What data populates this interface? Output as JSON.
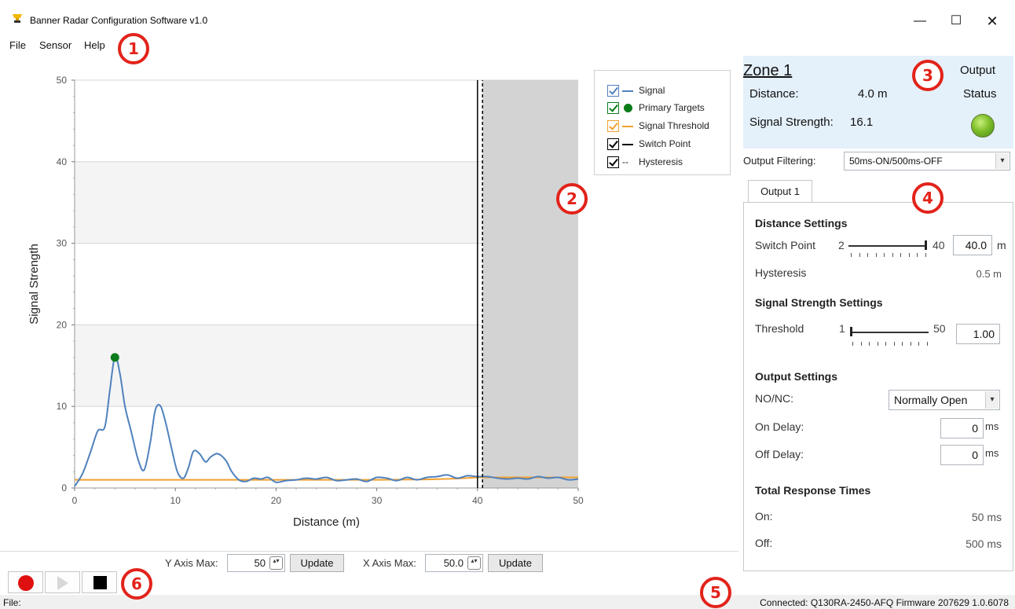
{
  "window": {
    "title": "Banner Radar Configuration Software v1.0",
    "minimize": "—",
    "maximize": "☐",
    "close": "✕"
  },
  "menu": {
    "file": "File",
    "sensor": "Sensor",
    "help": "Help"
  },
  "callouts": [
    "1",
    "2",
    "3",
    "4",
    "5",
    "6"
  ],
  "chart_data": {
    "type": "line",
    "xlabel": "Distance (m)",
    "ylabel": "Signal Strength",
    "xlim": [
      0,
      50
    ],
    "ylim": [
      0,
      50
    ],
    "xticks": [
      0,
      10,
      20,
      30,
      40,
      50
    ],
    "yticks": [
      0,
      10,
      20,
      30,
      40,
      50
    ],
    "grid": true,
    "legend_position": "top-right",
    "series": [
      {
        "name": "Signal",
        "color": "#4f81bd",
        "x": [
          0,
          0.8,
          1.6,
          2.3,
          3.0,
          3.5,
          4.0,
          4.5,
          5.0,
          5.6,
          6.3,
          6.9,
          7.5,
          8.0,
          8.5,
          9.0,
          9.6,
          10.2,
          10.8,
          11.3,
          11.8,
          12.4,
          13.0,
          13.5,
          14.2,
          15.0,
          15.6,
          16.3,
          17.0,
          17.8,
          18.5,
          19.2,
          20.0,
          21.0,
          22.0,
          23.0,
          24.0,
          25.0,
          26.0,
          27.0,
          28.0,
          29.0,
          30.0,
          31.0,
          32.0,
          33.0,
          34.0,
          35.0,
          36.0,
          37.0,
          38.0,
          39.0,
          40.0,
          41.0,
          42.0,
          43.0,
          44.0,
          45.0,
          46.0,
          47.0,
          48.0,
          49.0,
          50.0
        ],
        "y": [
          0.2,
          1.8,
          4.5,
          7.0,
          7.5,
          12.0,
          16.1,
          14.0,
          10.0,
          7.0,
          3.5,
          2.2,
          5.5,
          9.5,
          10.1,
          8.2,
          5.0,
          2.0,
          1.2,
          2.5,
          4.5,
          4.2,
          3.2,
          3.8,
          4.2,
          3.4,
          2.0,
          1.0,
          0.8,
          1.2,
          1.1,
          1.3,
          0.7,
          0.9,
          1.0,
          1.2,
          1.1,
          1.3,
          0.9,
          1.0,
          1.1,
          0.8,
          1.3,
          1.2,
          0.9,
          1.3,
          1.0,
          1.3,
          1.4,
          1.6,
          1.2,
          1.5,
          1.4,
          1.4,
          1.2,
          1.1,
          1.2,
          1.1,
          1.4,
          1.2,
          1.3,
          1.0,
          1.1
        ]
      },
      {
        "name": "Primary Targets",
        "color": "#0b7c1a",
        "x": [
          4.0
        ],
        "y": [
          16.0
        ]
      },
      {
        "name": "Signal Threshold",
        "color": "#f0a030",
        "x": [
          0,
          10,
          20,
          30,
          35,
          38,
          40,
          50
        ],
        "y": [
          1.0,
          1.0,
          1.0,
          1.0,
          1.05,
          1.15,
          1.3,
          1.3
        ]
      },
      {
        "name": "Switch Point",
        "color": "#000000",
        "x": [
          40,
          40
        ],
        "y": [
          0,
          50
        ]
      },
      {
        "name": "Hysteresis",
        "color": "#000000",
        "x": [
          40.5,
          40.5
        ],
        "y": [
          0,
          50
        ]
      }
    ],
    "shaded_region_x": [
      40.5,
      50
    ]
  },
  "legend": {
    "signal": "Signal",
    "primary": "Primary Targets",
    "threshold": "Signal Threshold",
    "switch": "Switch Point",
    "hysteresis": "Hysteresis",
    "dash_glyph": "--"
  },
  "zone": {
    "title": "Zone 1",
    "distance_label": "Distance:",
    "distance_value": "4.0 m",
    "strength_label": "Signal Strength:",
    "strength_value": "16.1",
    "output_label": "Output",
    "status_label": "Status"
  },
  "filter": {
    "label": "Output Filtering:",
    "value": "50ms-ON/500ms-OFF",
    "arrow": "▾"
  },
  "tab": {
    "label": "Output 1"
  },
  "distance_settings": {
    "heading": "Distance Settings",
    "switch_label": "Switch Point",
    "min": "2",
    "max": "40",
    "value": "40.0",
    "unit": "m",
    "level": 1.0,
    "hyst_label": "Hysteresis",
    "hyst_value": "0.5 m"
  },
  "signal_settings": {
    "heading": "Signal Strength Settings",
    "threshold_label": "Threshold",
    "min": "1",
    "max": "50",
    "value": "1.00",
    "level": 0.0
  },
  "output_settings": {
    "heading": "Output Settings",
    "nonc_label": "NO/NC:",
    "nonc_value": "Normally Open",
    "arrow": "▾",
    "on_label": "On Delay:",
    "on_value": "0",
    "on_unit": "ms",
    "off_label": "Off Delay:",
    "off_value": "0",
    "off_unit": "ms"
  },
  "response": {
    "heading": "Total Response Times",
    "on_label": "On:",
    "on_value": "50 ms",
    "off_label": "Off:",
    "off_value": "500 ms"
  },
  "axis_controls": {
    "y_label": "Y Axis Max:",
    "y_value": "50",
    "x_label": "X Axis Max:",
    "x_value": "50.0",
    "update": "Update",
    "spin_glyph": "▴▾"
  },
  "status": {
    "left": "File:",
    "right": "Connected: Q130RA-2450-AFQ Firmware 207629 1.0.6078"
  }
}
